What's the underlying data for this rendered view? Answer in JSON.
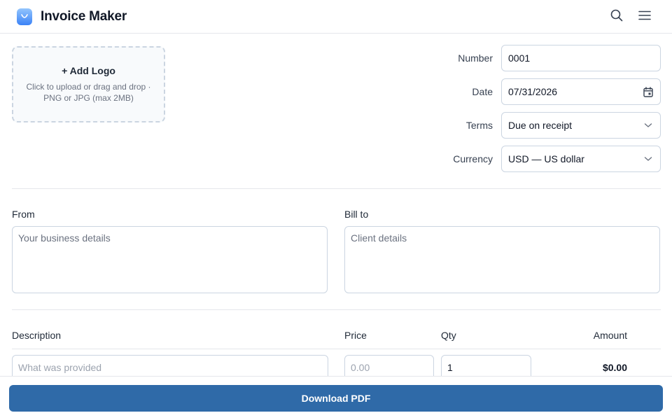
{
  "header": {
    "title": "Invoice Maker",
    "icons": [
      "app-logo-icon",
      "search-icon",
      "menu-icon"
    ]
  },
  "logo_upload": {
    "title": "+ Add Logo",
    "hint": "Click to upload or drag and drop · PNG or JPG (max 2MB)"
  },
  "meta": {
    "number": {
      "label": "Number",
      "value": "0001"
    },
    "date": {
      "label": "Date",
      "value": "07/31/2026"
    },
    "terms": {
      "label": "Terms",
      "value": "Due on receipt"
    },
    "currency": {
      "label": "Currency",
      "value": "USD — US dollar"
    }
  },
  "parties": {
    "from": {
      "label": "From",
      "placeholder": "Your business details"
    },
    "bill_to": {
      "label": "Bill to",
      "placeholder": "Client details"
    }
  },
  "items": {
    "headers": {
      "description": "Description",
      "price": "Price",
      "qty": "Qty",
      "amount": "Amount"
    },
    "rows": [
      {
        "description_placeholder": "What was provided",
        "price_placeholder": "0.00",
        "qty": "1",
        "amount": "$0.00"
      }
    ]
  },
  "footer": {
    "download_label": "Download PDF"
  },
  "colors": {
    "primary": "#2f6aa8",
    "border": "#cbd5e1",
    "brand_gradient_top": "#93c5fd",
    "brand_gradient_bottom": "#3b82f6"
  }
}
